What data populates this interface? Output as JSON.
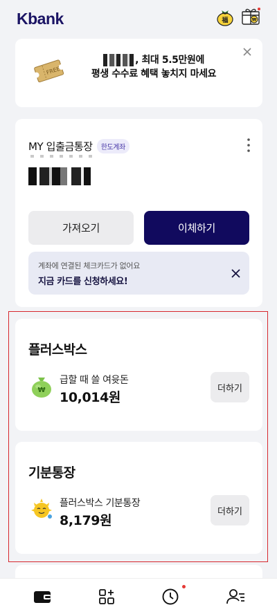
{
  "header": {
    "logo": "Kbank",
    "lucky_icon": "lucky-bag-icon",
    "gift_icon": "gift-icon"
  },
  "promo": {
    "line1_suffix": ", 최대 5.5만원에",
    "line2": "평생 수수료 혜택 놓치지 마세요",
    "image": "coupon-ticket-icon"
  },
  "account": {
    "title": "MY 입출금통장",
    "badge": "한도계좌",
    "fetch_label": "가져오기",
    "transfer_label": "이체하기",
    "notice_sub": "계좌에 연결된 체크카드가 없어요",
    "notice_main": "지금 카드를 신청하세요!"
  },
  "plusbox": {
    "title": "플러스박스",
    "label": "급할 때 쓸 여윳돈",
    "amount": "10,014원",
    "add_label": "더하기",
    "icon": "money-bag-icon"
  },
  "moodbox": {
    "title": "기분통장",
    "label": "플러스박스 기분통장",
    "amount": "8,179원",
    "add_label": "더하기",
    "icon": "sun-face-icon"
  },
  "tabbar": {
    "items": [
      "wallet-icon",
      "apps-plus-icon",
      "clock-icon",
      "user-menu-icon"
    ],
    "notification_color": "#e53935"
  },
  "colors": {
    "brand": "#1b1464",
    "primary_button": "#110a5e",
    "highlight_outline": "#d6262c"
  }
}
